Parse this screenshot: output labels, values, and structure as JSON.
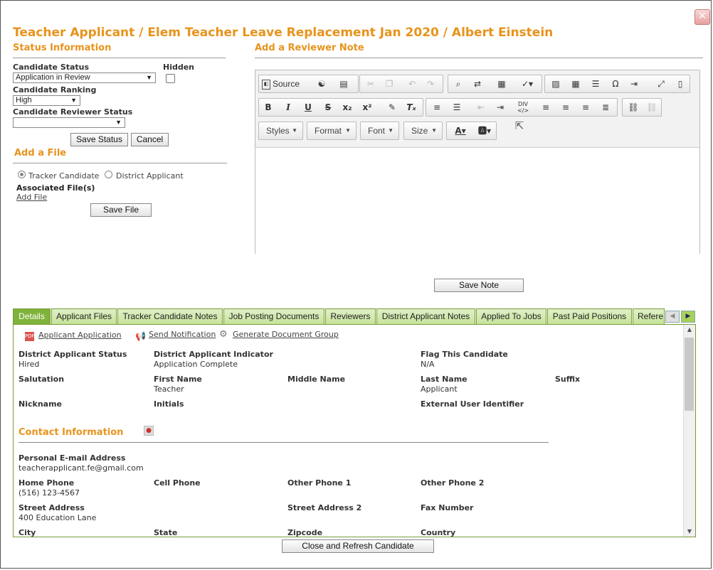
{
  "title": "Teacher Applicant / Elem Teacher Leave Replacement Jan 2020 / Albert Einstein",
  "close_glyph": "✕",
  "status": {
    "heading": "Status Information",
    "candidate_status_label": "Candidate Status",
    "candidate_status_value": "Application in Review",
    "hidden_label": "Hidden",
    "ranking_label": "Candidate Ranking",
    "ranking_value": "High",
    "reviewer_status_label": "Candidate Reviewer Status",
    "reviewer_status_value": "",
    "save_status": "Save Status",
    "cancel": "Cancel"
  },
  "file": {
    "heading": "Add a File",
    "radio_tracker": "Tracker Candidate",
    "radio_district": "District Applicant",
    "associated_label": "Associated File(s)",
    "add_file_link": "Add File",
    "save_file": "Save File"
  },
  "note": {
    "heading": "Add a Reviewer Note",
    "source_label": "Source",
    "styles": "Styles",
    "format": "Format",
    "font": "Font",
    "size": "Size",
    "save_note": "Save Note"
  },
  "tabs": [
    "Details",
    "Applicant Files",
    "Tracker Candidate Notes",
    "Job Posting Documents",
    "Reviewers",
    "District Applicant Notes",
    "Applied To Jobs",
    "Past Paid Positions",
    "Refere"
  ],
  "details": {
    "links": {
      "applicant_application": "Applicant Application",
      "send_notification": "Send Notification",
      "generate_document_group": "Generate Document Group"
    },
    "fields": {
      "district_applicant_status": {
        "label": "District Applicant Status",
        "value": "Hired"
      },
      "district_applicant_indicator": {
        "label": "District Applicant Indicator",
        "value": "Application Complete"
      },
      "flag_candidate": {
        "label": "Flag This Candidate",
        "value": "N/A"
      },
      "salutation": {
        "label": "Salutation",
        "value": ""
      },
      "first_name": {
        "label": "First Name",
        "value": "Teacher"
      },
      "middle_name": {
        "label": "Middle Name",
        "value": ""
      },
      "last_name": {
        "label": "Last Name",
        "value": "Applicant"
      },
      "suffix": {
        "label": "Suffix",
        "value": ""
      },
      "nickname": {
        "label": "Nickname",
        "value": ""
      },
      "initials": {
        "label": "Initials",
        "value": ""
      },
      "external_user_identifier": {
        "label": "External User Identifier",
        "value": ""
      }
    },
    "contact_heading": "Contact Information",
    "contact": {
      "email": {
        "label": "Personal E-mail Address",
        "value": "teacherapplicant.fe@gmail.com"
      },
      "home_phone": {
        "label": "Home Phone",
        "value": "(516) 123-4567"
      },
      "cell_phone": {
        "label": "Cell Phone",
        "value": ""
      },
      "other_phone_1": {
        "label": "Other Phone 1",
        "value": ""
      },
      "other_phone_2": {
        "label": "Other Phone 2",
        "value": ""
      },
      "street_address": {
        "label": "Street Address",
        "value": "400 Education Lane"
      },
      "street_address_2": {
        "label": "Street Address 2",
        "value": ""
      },
      "fax_number": {
        "label": "Fax Number",
        "value": ""
      },
      "city": {
        "label": "City",
        "value": ""
      },
      "state": {
        "label": "State",
        "value": ""
      },
      "zipcode": {
        "label": "Zipcode",
        "value": ""
      },
      "country": {
        "label": "Country",
        "value": ""
      }
    }
  },
  "close_refresh": "Close and Refresh Candidate",
  "colors": {
    "accent": "#e8931c",
    "tab_active": "#7fb33b",
    "tab_inactive": "#d3eab0"
  }
}
